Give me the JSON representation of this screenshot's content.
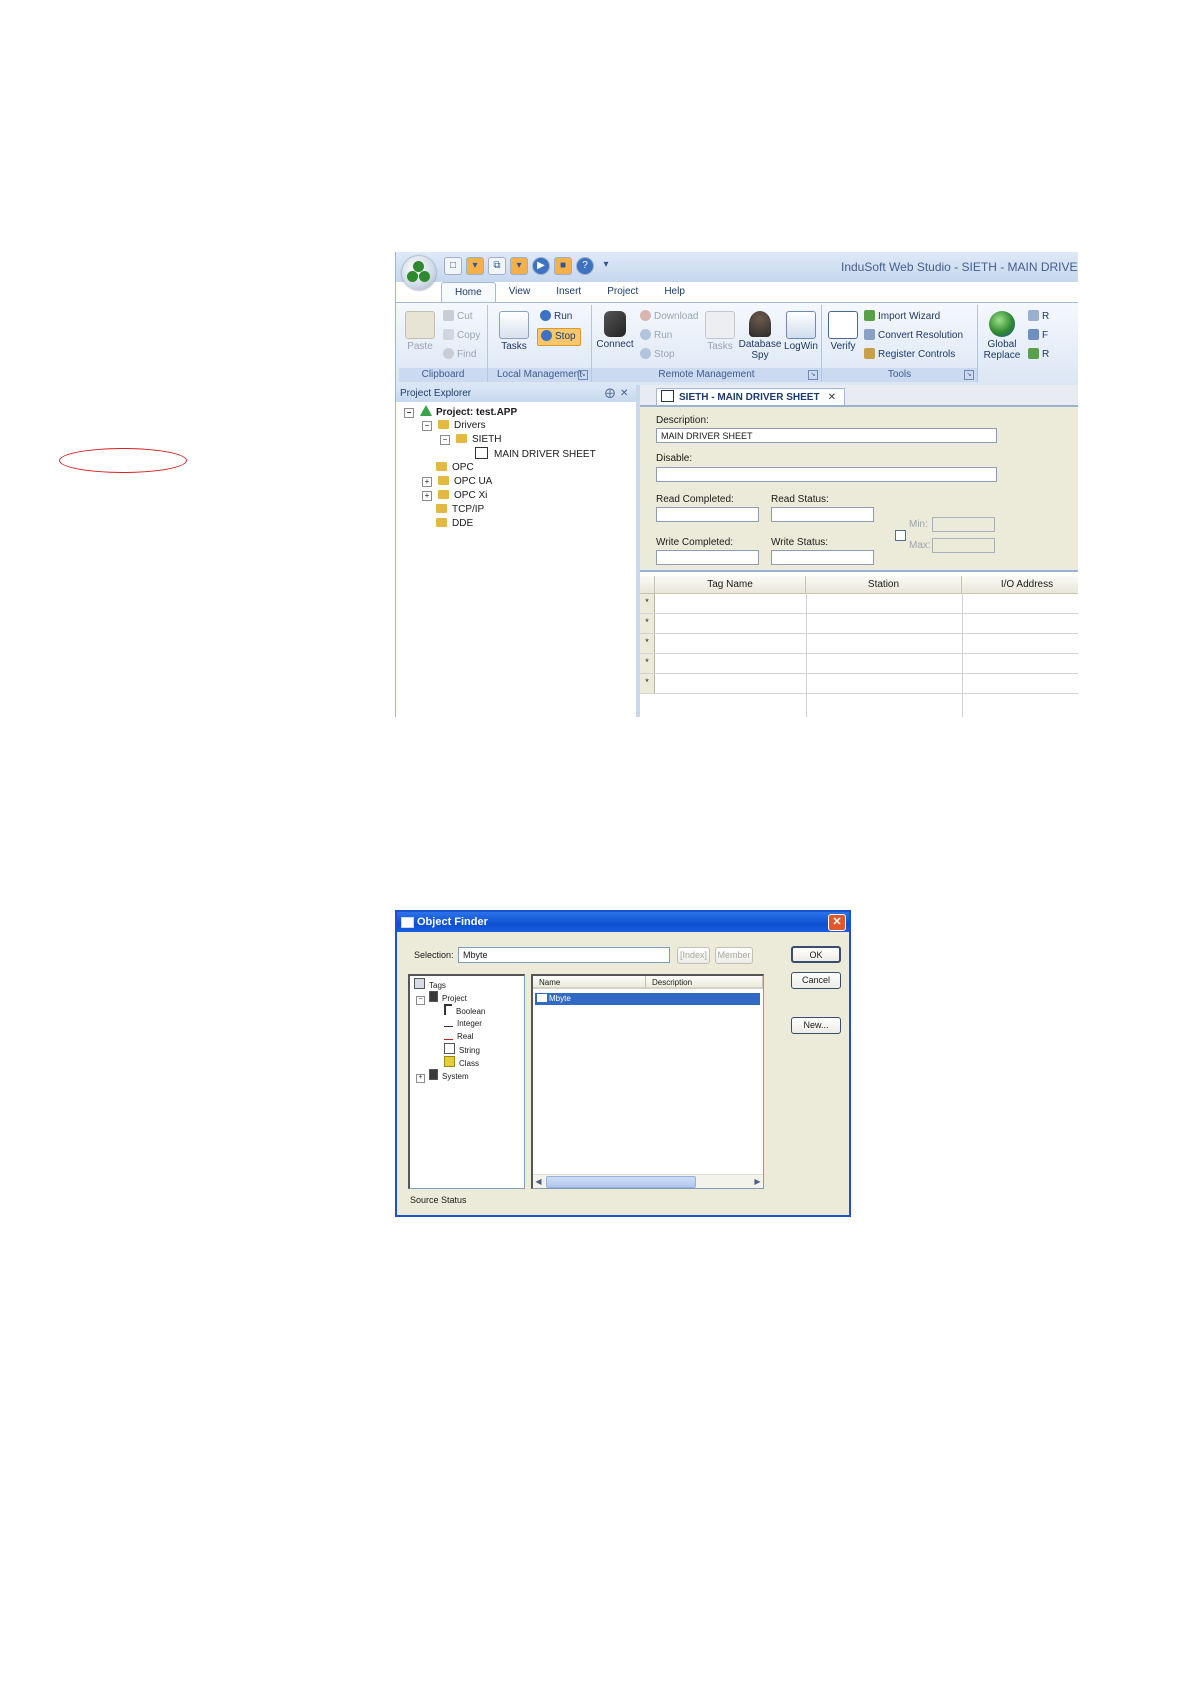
{
  "ide": {
    "app_title": "InduSoft Web Studio - SIETH - MAIN DRIVER",
    "ribbon_tabs": [
      "Home",
      "View",
      "Insert",
      "Project",
      "Help"
    ],
    "clipboard": {
      "group": "Clipboard",
      "paste": "Paste",
      "cut": "Cut",
      "copy": "Copy",
      "find": "Find"
    },
    "local_mgmt": {
      "group": "Local Management",
      "tasks": "Tasks",
      "run": "Run",
      "stop": "Stop"
    },
    "remote_mgmt": {
      "group": "Remote Management",
      "connect": "Connect",
      "download": "Download",
      "run": "Run",
      "stop": "Stop",
      "tasks": "Tasks",
      "database_spy_1": "Database",
      "database_spy_2": "Spy",
      "logwin": "LogWin"
    },
    "tools": {
      "group": "Tools",
      "verify": "Verify",
      "import_wizard": "Import Wizard",
      "convert_resolution": "Convert Resolution",
      "register_controls": "Register Controls",
      "global_replace_1": "Global",
      "global_replace_2": "Replace",
      "cut1": "R",
      "cut2": "F",
      "cut3": "R"
    },
    "explorer": {
      "title": "Project Explorer",
      "pin": "⨁",
      "close": "✕",
      "tree": {
        "project": "Project: test.APP",
        "drivers": "Drivers",
        "sieth": "SIETH",
        "main_sheet": "MAIN DRIVER SHEET",
        "opc": "OPC",
        "opc_ua": "OPC UA",
        "opc_xi": "OPC Xi",
        "tcpip": "TCP/IP",
        "dde": "DDE"
      }
    },
    "document": {
      "tab": "SIETH - MAIN DRIVER SHEET",
      "tab_close": "✕",
      "description_label": "Description:",
      "description_value": "MAIN DRIVER SHEET",
      "disable_label": "Disable:",
      "read_completed": "Read Completed:",
      "read_status": "Read Status:",
      "write_completed": "Write Completed:",
      "write_status": "Write Status:",
      "min": "Min:",
      "max": "Max:",
      "columns": [
        "Tag Name",
        "Station",
        "I/O Address"
      ],
      "row_marker": "*"
    },
    "colors": {
      "accent": "#1b3a72",
      "selection_circle": "#d92020"
    }
  },
  "finder": {
    "title": "Object Finder",
    "selection_label": "Selection:",
    "selection_value": "Mbyte",
    "index_button": "[Index]",
    "member_button": "Member",
    "ok": "OK",
    "cancel": "Cancel",
    "new": "New...",
    "tree": {
      "tags": "Tags",
      "project": "Project",
      "boolean": "Boolean",
      "integer": "Integer",
      "real": "Real",
      "string": "String",
      "class": "Class",
      "system": "System"
    },
    "list_columns": [
      "Name",
      "Description"
    ],
    "selected_row": "Mbyte",
    "status": "Source Status",
    "colors": {
      "title_bar": "#0d4fd1",
      "selection": "#316ac5"
    }
  }
}
